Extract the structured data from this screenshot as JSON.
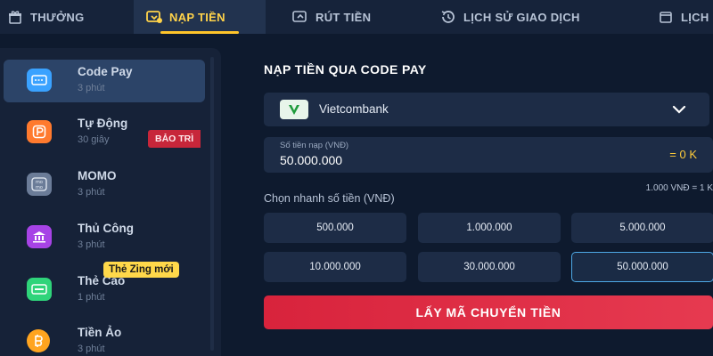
{
  "topnav": {
    "tabs": [
      {
        "label": "THƯỞNG",
        "icon": "gift-icon"
      },
      {
        "label": "NẠP TIỀN",
        "icon": "deposit-icon",
        "active": true
      },
      {
        "label": "RÚT TIỀN",
        "icon": "withdraw-icon"
      },
      {
        "label": "LỊCH SỬ GIAO DỊCH",
        "icon": "history-icon"
      },
      {
        "label": "LỊCH",
        "icon": "calendar-icon"
      }
    ]
  },
  "sidebar": {
    "methods": [
      {
        "name": "Code Pay",
        "time": "3 phút",
        "icon": "card-icon",
        "color": "#3aa2ff",
        "active": true
      },
      {
        "name": "Tự Động",
        "time": "30 giây",
        "icon": "p-icon",
        "color": "#ff7a2e"
      },
      {
        "name": "MOMO",
        "time": "3 phút",
        "icon": "momo-icon",
        "color": "#6b7c98"
      },
      {
        "name": "Thủ Công",
        "time": "3 phút",
        "icon": "bank-icon",
        "color": "#a743e6"
      },
      {
        "name": "Thẻ Cào",
        "time": "1 phút",
        "icon": "scratch-card-icon",
        "color": "#2fd47a"
      },
      {
        "name": "Tiền Ảo",
        "time": "3 phút",
        "icon": "bitcoin-icon",
        "color": "#ffa41f"
      }
    ],
    "maintenance_badge": "BẢO TRÌ",
    "zing_badge": "Thẻ Zing mới"
  },
  "main": {
    "title": "NẠP TIỀN QUA CODE PAY",
    "bank": {
      "name": "Vietcombank",
      "icon": "vietcombank-logo"
    },
    "amount": {
      "label": "Số tiền nạp (VNĐ)",
      "value": "50.000.000",
      "converted": "= 0 K"
    },
    "rate": "1.000 VNĐ = 1 K",
    "quick_label": "Chọn nhanh số tiền (VNĐ)",
    "quick_amounts": [
      "500.000",
      "1.000.000",
      "5.000.000",
      "10.000.000",
      "30.000.000",
      "50.000.000"
    ],
    "selected_amount": "50.000.000",
    "cta_label": "LẤY MÃ CHUYỂN TIỀN"
  },
  "colors": {
    "accent_yellow": "#ffc52a",
    "cta_red": "#d8233c",
    "selected_border": "#4ea9e6"
  }
}
